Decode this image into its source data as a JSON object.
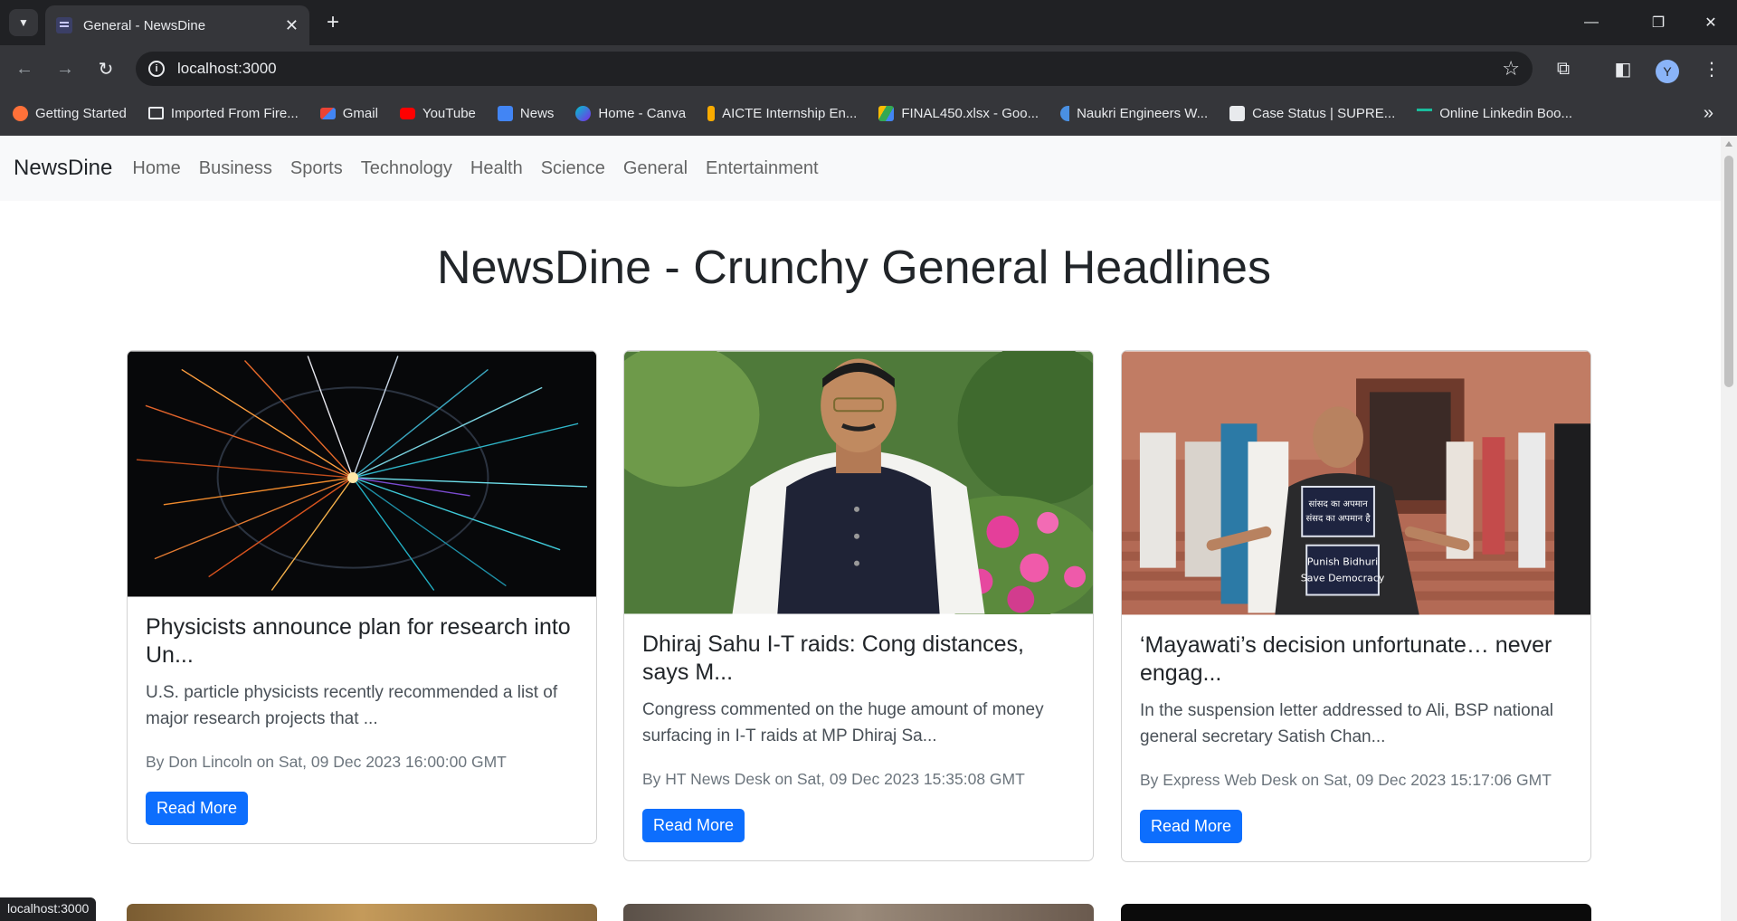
{
  "browser": {
    "tab_title": "General - NewsDine",
    "url": "localhost:3000",
    "avatar_letter": "Y",
    "status_url": "localhost:3000",
    "bookmarks": [
      {
        "label": "Getting Started",
        "icon": "firefox-icon",
        "color": "#ff7139"
      },
      {
        "label": "Imported From Fire...",
        "icon": "folder-icon",
        "color": "#e8eaed"
      },
      {
        "label": "Gmail",
        "icon": "gmail-icon",
        "color": "#ea4335"
      },
      {
        "label": "YouTube",
        "icon": "youtube-icon",
        "color": "#ff0000"
      },
      {
        "label": "News",
        "icon": "google-news-icon",
        "color": "#4285f4"
      },
      {
        "label": "Home - Canva",
        "icon": "canva-icon",
        "color": "#00c4cc"
      },
      {
        "label": "AICTE Internship En...",
        "icon": "aicte-icon",
        "color": "#f9ab00"
      },
      {
        "label": "FINAL450.xlsx - Goo...",
        "icon": "google-drive-icon",
        "color": "#34a853"
      },
      {
        "label": "Naukri Engineers W...",
        "icon": "naukri-icon",
        "color": "#4a90e2"
      },
      {
        "label": "Case Status | SUPRE...",
        "icon": "supreme-court-icon",
        "color": "#e8eaed"
      },
      {
        "label": "Online Linkedin Boo...",
        "icon": "linkedin-booster-icon",
        "color": "#1abc9c"
      }
    ]
  },
  "site": {
    "brand": "NewsDine",
    "nav": [
      "Home",
      "Business",
      "Sports",
      "Technology",
      "Health",
      "Science",
      "General",
      "Entertainment"
    ],
    "heading": "NewsDine - Crunchy General Headlines"
  },
  "articles": [
    {
      "title": "Physicists announce plan for research into Un...",
      "description": "U.S. particle physicists recently recommended a list of major research projects that ...",
      "meta": "By Don Lincoln on Sat, 09 Dec 2023 16:00:00 GMT",
      "button": "Read More"
    },
    {
      "title": "Dhiraj Sahu I-T raids: Cong distances, says M...",
      "description": "Congress commented on the huge amount of money surfacing in I-T raids at MP Dhiraj Sa...",
      "meta": "By HT News Desk on Sat, 09 Dec 2023 15:35:08 GMT",
      "button": "Read More"
    },
    {
      "title": "‘Mayawati’s decision unfortunate… never engag...",
      "description": "In the suspension letter addressed to Ali, BSP national general secretary Satish Chan...",
      "meta": "By Express Web Desk on Sat, 09 Dec 2023 15:17:06 GMT",
      "button": "Read More"
    }
  ],
  "image_text": {
    "placard_top": "सांसद का अपमान संसद का अपमान है",
    "placard_bottom": "Punish Bidhuri Save Democracy"
  },
  "colors": {
    "primary_button": "#0d6efd",
    "navbar_bg": "#f8f9fa",
    "chrome_dark": "#202124",
    "chrome_mid": "#35363a"
  }
}
